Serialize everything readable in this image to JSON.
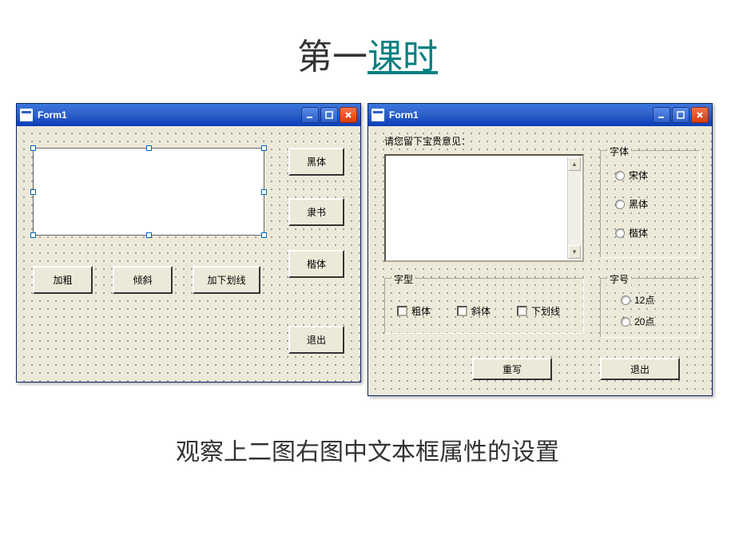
{
  "title": {
    "part1": "第一",
    "part2": "课时"
  },
  "form1": {
    "title": "Form1",
    "buttons": {
      "heiti": "黑体",
      "lishu": "隶书",
      "kaiti": "楷体",
      "bold": "加粗",
      "italic": "倾斜",
      "underline": "加下划线",
      "exit": "退出"
    }
  },
  "form2": {
    "title": "Form1",
    "prompt": "请您留下宝贵意见：",
    "groups": {
      "font": "字体",
      "style": "字型",
      "size": "字号"
    },
    "fonts": {
      "song": "宋体",
      "hei": "黑体",
      "kai": "楷体"
    },
    "styles": {
      "bold": "粗体",
      "italic": "斜体",
      "underline": "下划线"
    },
    "sizes": {
      "s12": "12点",
      "s20": "20点"
    },
    "buttons": {
      "rewrite": "重写",
      "exit": "退出"
    }
  },
  "footer": "观察上二图右图中文本框属性的设置"
}
